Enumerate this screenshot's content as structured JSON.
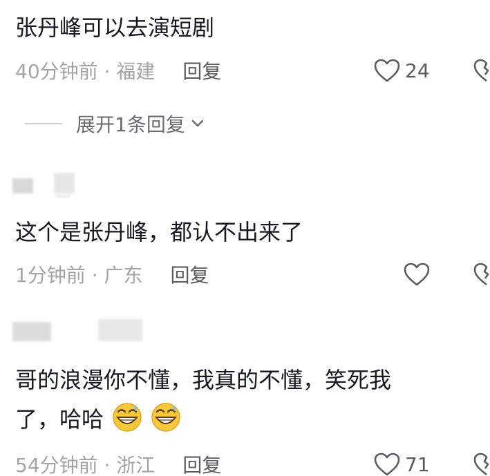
{
  "comments": [
    {
      "text": "张丹峰可以去演短剧",
      "time_location": "40分钟前 · 福建",
      "reply_label": "回复",
      "likes": "24"
    },
    {
      "text": "这个是张丹峰，都认不出来了",
      "time_location": "1分钟前 · 广东",
      "reply_label": "回复",
      "likes": ""
    },
    {
      "text_line1": "哥的浪漫你不懂，我真的不懂，笑死我",
      "text_line2": "了，哈哈",
      "time_location": "54分钟前 · 浙江",
      "reply_label": "回复",
      "likes": "71"
    }
  ],
  "expand_replies_label": "展开1条回复",
  "icons": {
    "like": "heart-outline-icon",
    "dislike": "broken-heart-icon",
    "expand": "chevron-down-icon",
    "emoji": "grinning-sweat-emoji"
  },
  "colors": {
    "text": "#161823",
    "meta": "#a3a3a8",
    "reply": "#5a5a62",
    "emoji_face": "#f7c83a"
  }
}
